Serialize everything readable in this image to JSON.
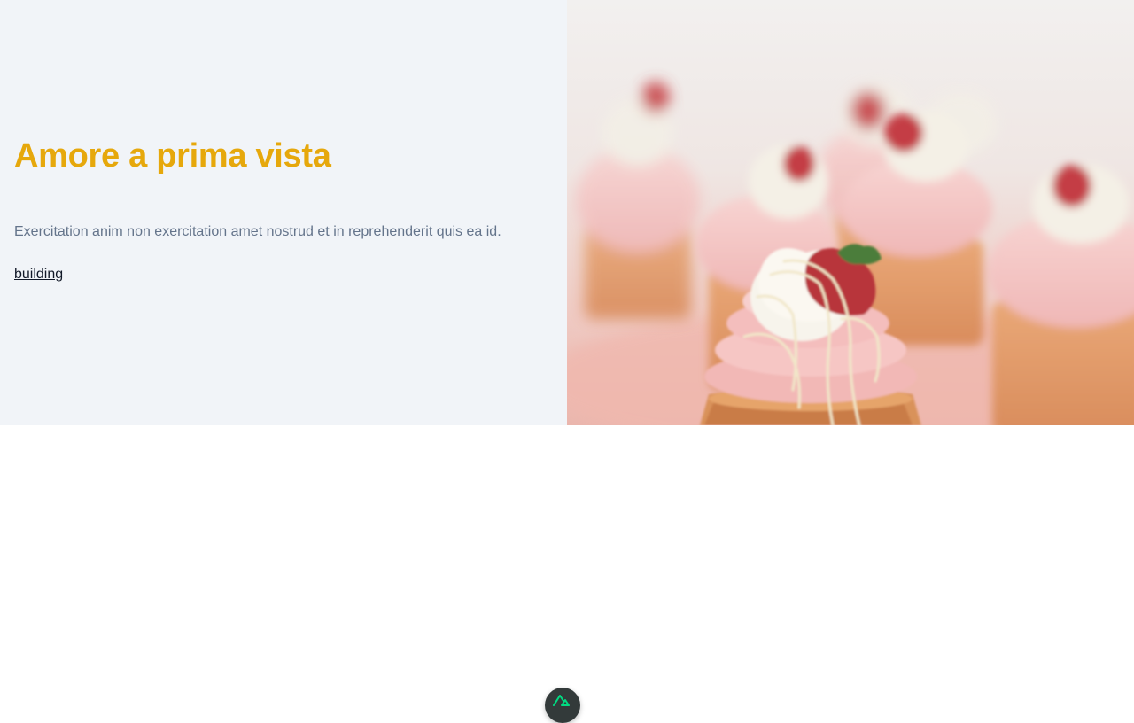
{
  "hero": {
    "title": "Amore a prima vista",
    "description": "Exercitation anim non exercitation amet nostrud et in reprehenderit quis ea id.",
    "link_label": "building",
    "image_alt": "cupcakes with strawberries",
    "colors": {
      "title": "#e6a80c",
      "text_panel_bg": "#f1f4f8",
      "description": "#64748b"
    }
  },
  "devtools_badge": {
    "icon": "nuxt-logo-icon",
    "color": "#00dc82"
  }
}
